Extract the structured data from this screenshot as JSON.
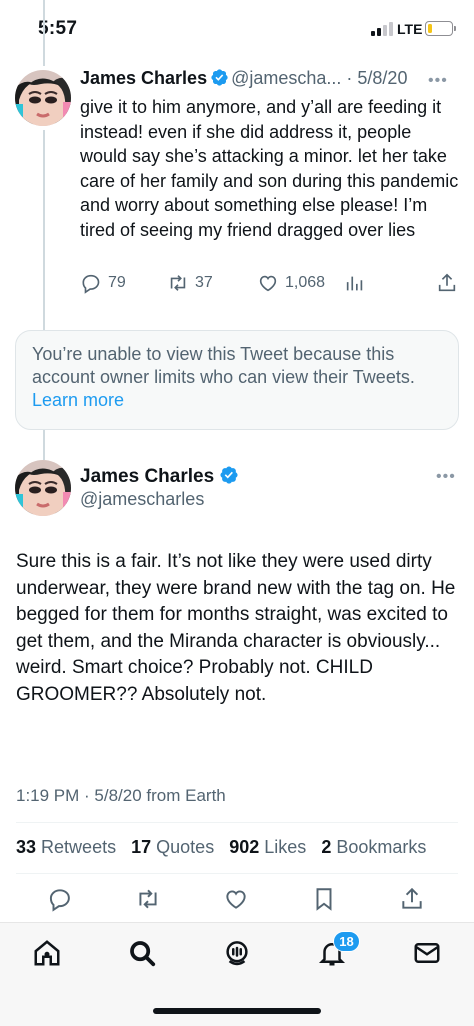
{
  "status_bar": {
    "time": "5:57",
    "network": "LTE",
    "battery_level": 0.2
  },
  "tweets": [
    {
      "name": "James Charles",
      "handle": "@jamescha...",
      "date": "5/8/20",
      "text": "give it to him anymore, and y’all are feeding it instead! even if she did address it, people would say she’s attacking a minor. let her take care of her family and son during this pandemic and worry about something else please! I’m tired of seeing my friend dragged over lies",
      "replies": "79",
      "retweets": "37",
      "likes": "1,068"
    }
  ],
  "limited_notice": {
    "text": "You’re unable to view this Tweet because this account owner limits who can view their Tweets.",
    "link": "Learn more"
  },
  "main_tweet": {
    "name": "James Charles",
    "handle": "@jamescharles",
    "text": "Sure this is a fair. It’s not like they were used dirty underwear, they were brand new with the tag on. He begged for them for months straight, was excited to get them, and the Miranda character is obviously... weird. Smart choice? Probably not. CHILD GROOMER?? Absolutely not.",
    "meta": "1:19 PM · 5/8/20 from Earth",
    "stats": {
      "retweets_count": "33",
      "retweets_label": "Retweets",
      "quotes_count": "17",
      "quotes_label": "Quotes",
      "likes_count": "902",
      "likes_label": "Likes",
      "bookmarks_count": "2",
      "bookmarks_label": "Bookmarks"
    }
  },
  "tab_bar": {
    "items": [
      "home-icon",
      "search-icon",
      "spaces-icon",
      "notifications-icon",
      "messages-icon"
    ],
    "notification_badge": "18"
  },
  "colors": {
    "accent": "#1d9bf0",
    "text": "#0f1419",
    "secondary": "#536471"
  }
}
